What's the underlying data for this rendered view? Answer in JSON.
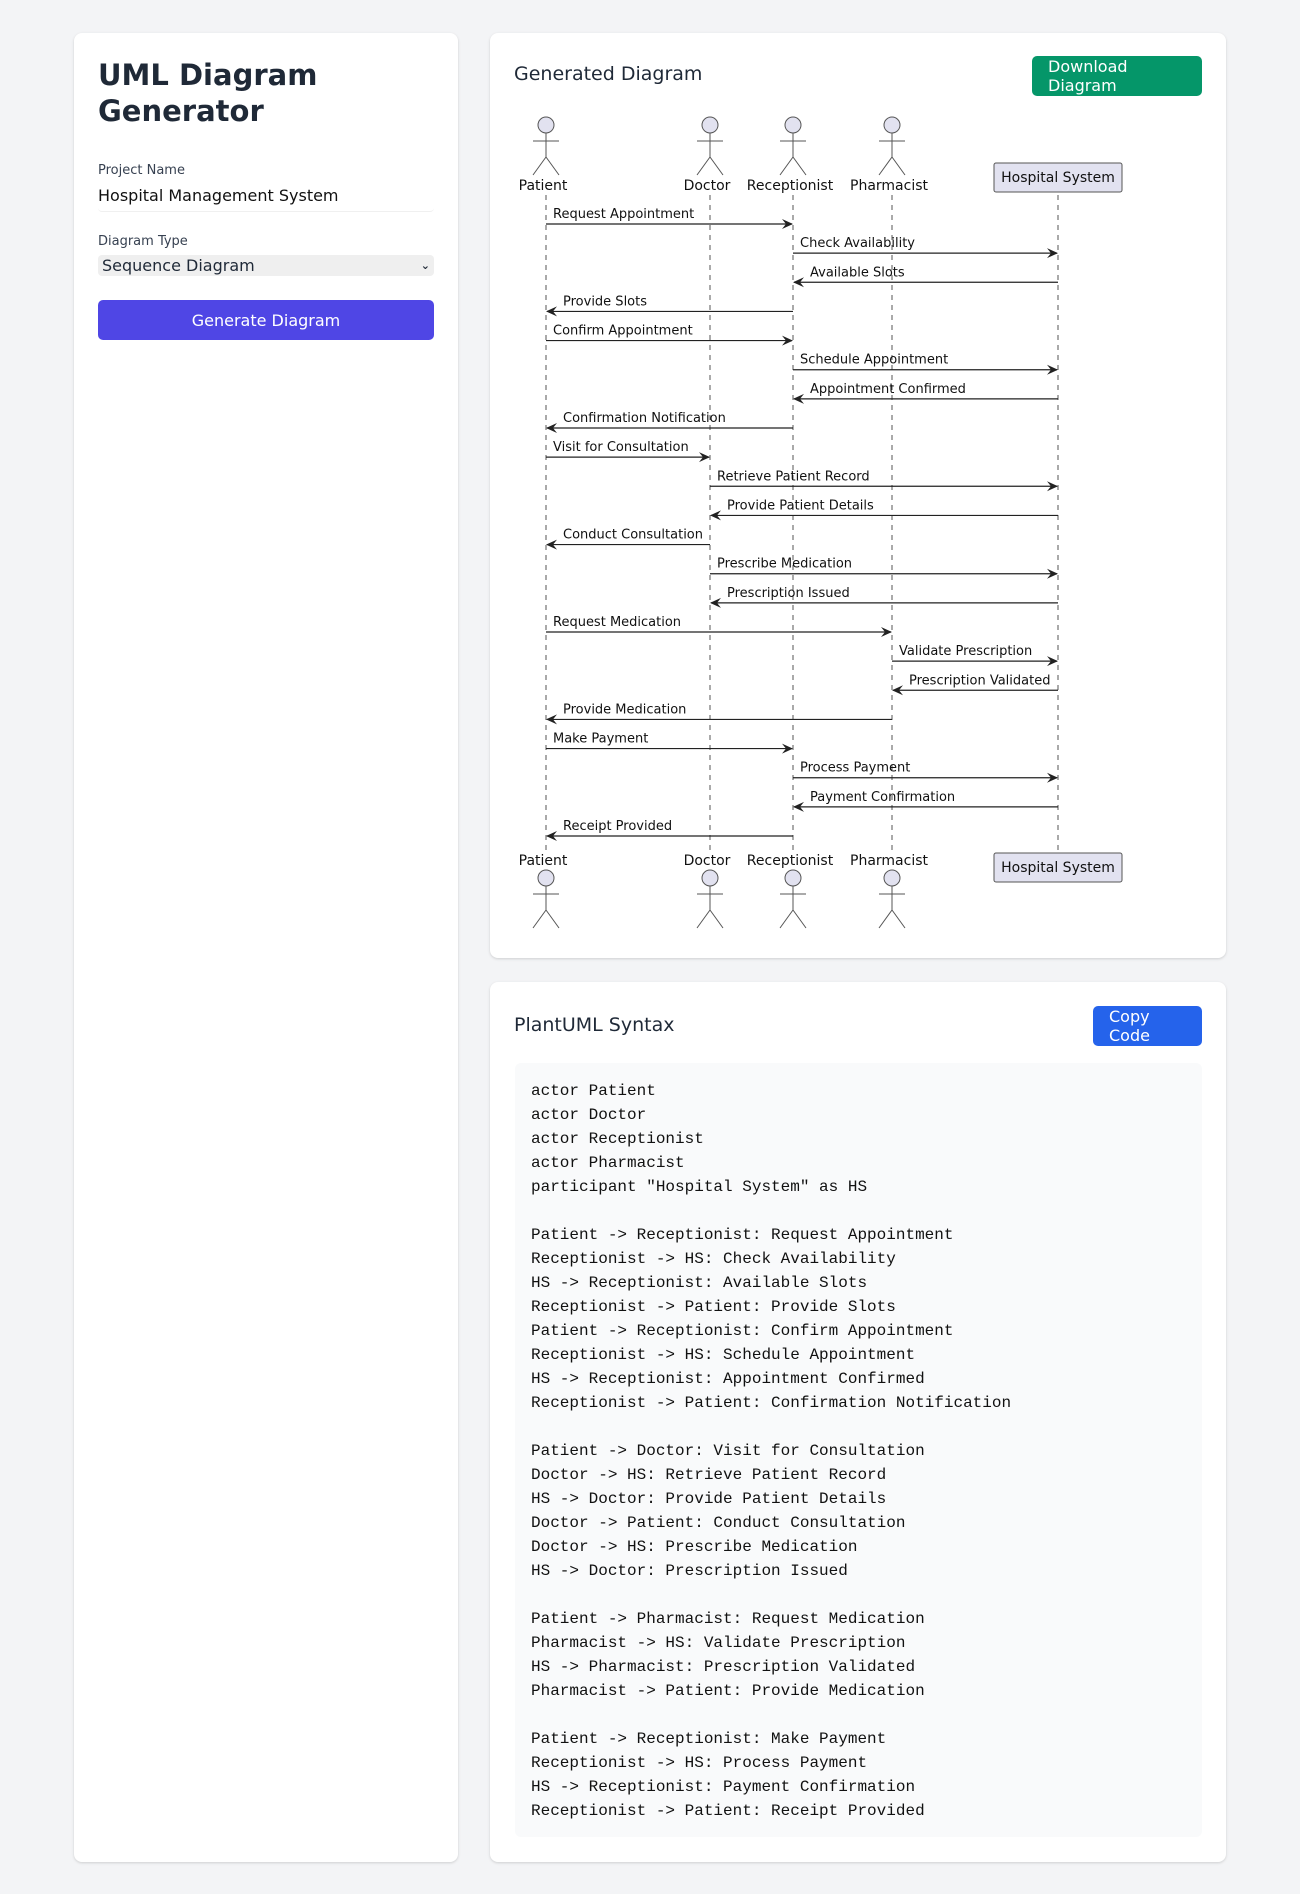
{
  "sidebar": {
    "title": "UML Diagram Generator",
    "project_name_label": "Project Name",
    "project_name_value": "Hospital Management System",
    "diagram_type_label": "Diagram Type",
    "diagram_type_value": "Sequence Diagram",
    "generate_button": "Generate Diagram"
  },
  "diagram_panel": {
    "title": "Generated Diagram",
    "download_button": "Download Diagram",
    "colors": {
      "actor_fill": "#e2e2f0",
      "line": "#555555",
      "download": "#059669",
      "generate": "#4f46e5",
      "copy": "#2563eb"
    },
    "participants": [
      {
        "name": "Patient",
        "type": "actor"
      },
      {
        "name": "Doctor",
        "type": "actor"
      },
      {
        "name": "Receptionist",
        "type": "actor"
      },
      {
        "name": "Pharmacist",
        "type": "actor"
      },
      {
        "name": "Hospital System",
        "type": "participant"
      }
    ],
    "messages": [
      {
        "from": 0,
        "to": 2,
        "text": "Request Appointment"
      },
      {
        "from": 2,
        "to": 4,
        "text": "Check Availability"
      },
      {
        "from": 4,
        "to": 2,
        "text": "Available Slots"
      },
      {
        "from": 2,
        "to": 0,
        "text": "Provide Slots"
      },
      {
        "from": 0,
        "to": 2,
        "text": "Confirm Appointment"
      },
      {
        "from": 2,
        "to": 4,
        "text": "Schedule Appointment"
      },
      {
        "from": 4,
        "to": 2,
        "text": "Appointment Confirmed"
      },
      {
        "from": 2,
        "to": 0,
        "text": "Confirmation Notification"
      },
      {
        "from": 0,
        "to": 1,
        "text": "Visit for Consultation"
      },
      {
        "from": 1,
        "to": 4,
        "text": "Retrieve Patient Record"
      },
      {
        "from": 4,
        "to": 1,
        "text": "Provide Patient Details"
      },
      {
        "from": 1,
        "to": 0,
        "text": "Conduct Consultation"
      },
      {
        "from": 1,
        "to": 4,
        "text": "Prescribe Medication"
      },
      {
        "from": 4,
        "to": 1,
        "text": "Prescription Issued"
      },
      {
        "from": 0,
        "to": 3,
        "text": "Request Medication"
      },
      {
        "from": 3,
        "to": 4,
        "text": "Validate Prescription"
      },
      {
        "from": 4,
        "to": 3,
        "text": "Prescription Validated"
      },
      {
        "from": 3,
        "to": 0,
        "text": "Provide Medication"
      },
      {
        "from": 0,
        "to": 2,
        "text": "Make Payment"
      },
      {
        "from": 2,
        "to": 4,
        "text": "Process Payment"
      },
      {
        "from": 4,
        "to": 2,
        "text": "Payment Confirmation"
      },
      {
        "from": 2,
        "to": 0,
        "text": "Receipt Provided"
      }
    ]
  },
  "code_panel": {
    "title": "PlantUML Syntax",
    "copy_button": "Copy Code",
    "code": "actor Patient\nactor Doctor\nactor Receptionist\nactor Pharmacist\nparticipant \"Hospital System\" as HS\n\nPatient -> Receptionist: Request Appointment\nReceptionist -> HS: Check Availability\nHS -> Receptionist: Available Slots\nReceptionist -> Patient: Provide Slots\nPatient -> Receptionist: Confirm Appointment\nReceptionist -> HS: Schedule Appointment\nHS -> Receptionist: Appointment Confirmed\nReceptionist -> Patient: Confirmation Notification\n\nPatient -> Doctor: Visit for Consultation\nDoctor -> HS: Retrieve Patient Record\nHS -> Doctor: Provide Patient Details\nDoctor -> Patient: Conduct Consultation\nDoctor -> HS: Prescribe Medication\nHS -> Doctor: Prescription Issued\n\nPatient -> Pharmacist: Request Medication\nPharmacist -> HS: Validate Prescription\nHS -> Pharmacist: Prescription Validated\nPharmacist -> Patient: Provide Medication\n\nPatient -> Receptionist: Make Payment\nReceptionist -> HS: Process Payment\nHS -> Receptionist: Payment Confirmation\nReceptionist -> Patient: Receipt Provided"
  }
}
